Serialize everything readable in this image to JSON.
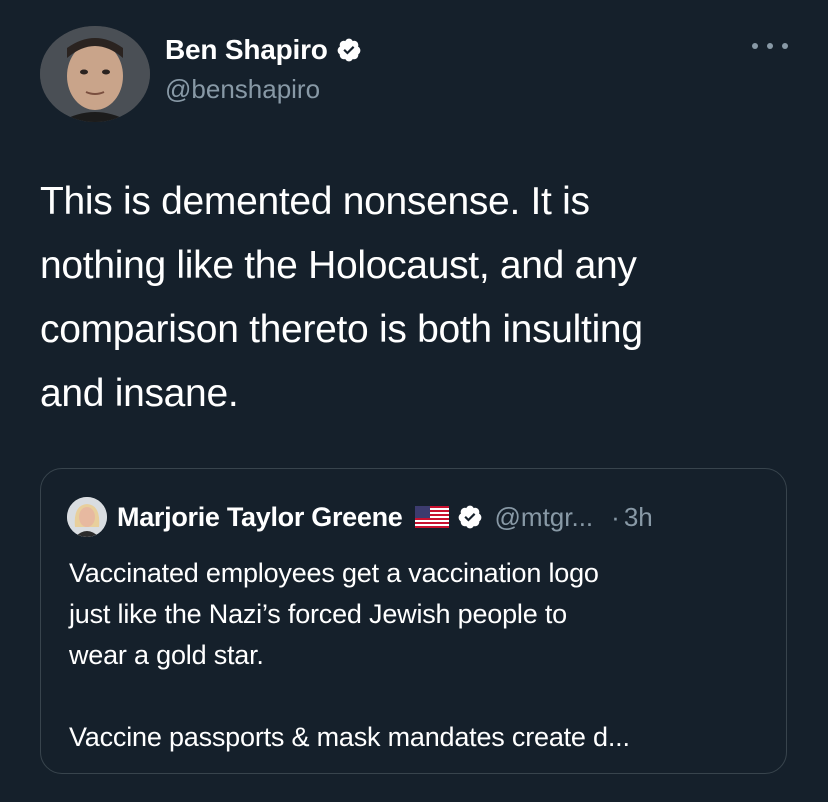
{
  "tweet": {
    "author_name": "Ben Shapiro",
    "author_handle": "@benshapiro",
    "verified_icon": "verified-badge-icon",
    "more_icon": "more-options-icon",
    "text": "This is demented nonsense. It is\nnothing like the Holocaust, and any\ncomparison thereto is both insulting\nand insane."
  },
  "quoted_tweet": {
    "author_name": "Marjorie Taylor Greene",
    "flag_icon": "us-flag-icon",
    "verified_icon": "verified-badge-icon",
    "author_handle": "@mtgr...",
    "separator": "·",
    "time": "3h",
    "text_paragraph_1": "Vaccinated employees get a vaccination logo\njust like the Nazi’s forced Jewish people to\nwear a gold star.",
    "text_paragraph_2": "Vaccine passports & mask mandates create d..."
  },
  "colors": {
    "background": "#15202b",
    "text_primary": "#ffffff",
    "text_secondary": "#8899a6",
    "border": "#38444d"
  }
}
